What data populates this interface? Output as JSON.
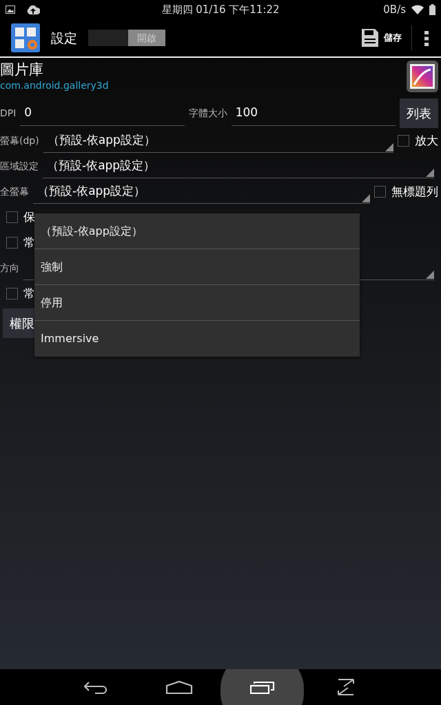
{
  "status_bar": {
    "time": "星期四 01/16 下午11:22",
    "speed": "0B/s"
  },
  "action_bar": {
    "title": "設定",
    "toggle": {
      "label": "開啟",
      "on": true
    },
    "save": "儲存"
  },
  "app": {
    "name": "圖片庫",
    "package": "com.android.gallery3d"
  },
  "fields": [
    {
      "label": "DPI",
      "value": "0"
    },
    {
      "label": "字體大小",
      "value": "100"
    }
  ],
  "list_button": "列表",
  "settings": [
    {
      "kind": "spinner",
      "label": "螢幕(dp)",
      "value": "（預設-依app設定）",
      "check": {
        "label": "放大",
        "checked": false
      }
    },
    {
      "kind": "spinner",
      "label": "區域設定",
      "value": "（預設-依app設定）"
    },
    {
      "kind": "spinner",
      "label": "全螢幕",
      "value": "（預設-依app設定）",
      "check": {
        "label": "無標題列",
        "checked": false
      }
    },
    {
      "kind": "checkbox",
      "label": "保",
      "checked": false
    },
    {
      "kind": "checkbox",
      "label": "常",
      "checked": false
    },
    {
      "kind": "spinner",
      "label": "方向"
    },
    {
      "kind": "checkbox",
      "label": "常",
      "checked": false
    },
    {
      "kind": "button",
      "label": "權限"
    }
  ],
  "dropdown": {
    "options": [
      {
        "label": "（預設-依app設定）",
        "selected": false
      },
      {
        "label": "強制",
        "selected": false
      },
      {
        "label": "停用",
        "selected": false
      },
      {
        "label": "Immersive",
        "selected": false
      }
    ]
  }
}
